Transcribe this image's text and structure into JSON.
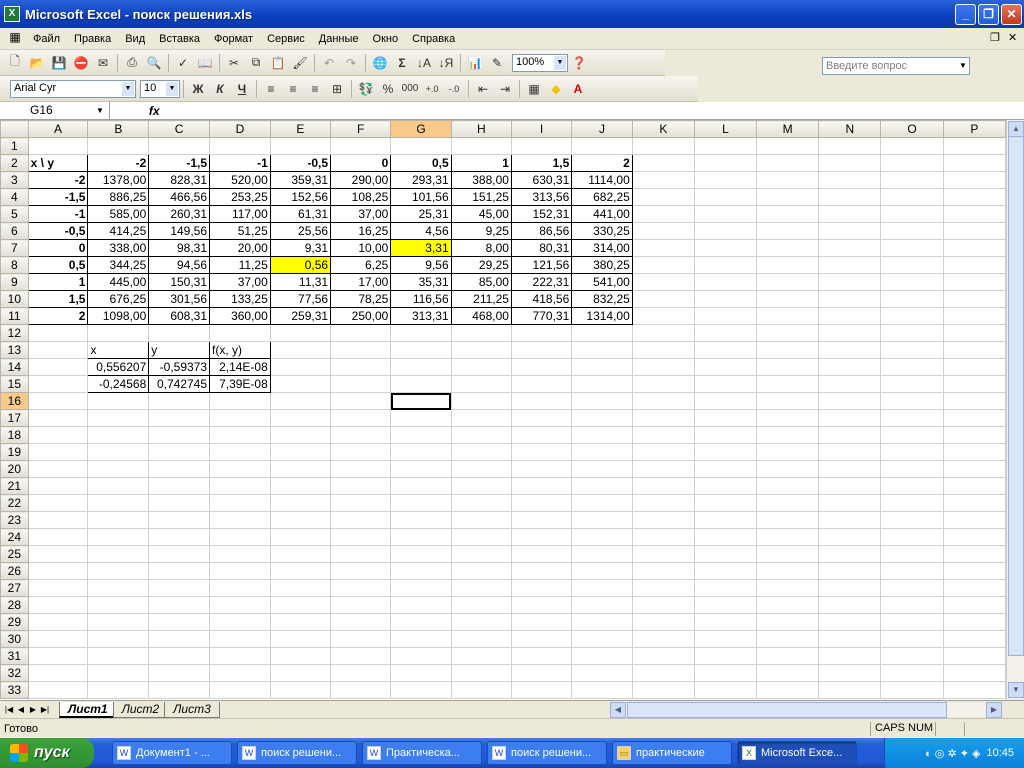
{
  "window": {
    "title": "Microsoft Excel - поиск решения.xls",
    "app_icon": "excel-icon"
  },
  "menu": [
    "Файл",
    "Правка",
    "Вид",
    "Вставка",
    "Формат",
    "Сервис",
    "Данные",
    "Окно",
    "Справка"
  ],
  "ask": {
    "placeholder": "Введите вопрос"
  },
  "toolbar": {
    "zoom": "100%"
  },
  "format_toolbar": {
    "font": "Arial Cyr",
    "size": "10",
    "bold": "Ж",
    "italic": "К",
    "underline": "Ч",
    "percent": "%",
    "thousands": "000"
  },
  "formula_bar": {
    "cell_ref": "G16",
    "fx": "fx",
    "content": ""
  },
  "columns": [
    "A",
    "B",
    "C",
    "D",
    "E",
    "F",
    "G",
    "H",
    "I",
    "J",
    "K",
    "L",
    "M",
    "N",
    "O",
    "P"
  ],
  "grid": {
    "header": [
      "x     \\     y",
      "-2",
      "-1,5",
      "-1",
      "-0,5",
      "0",
      "0,5",
      "1",
      "1,5",
      "2"
    ],
    "rows": [
      [
        "-2",
        "1378,00",
        "828,31",
        "520,00",
        "359,31",
        "290,00",
        "293,31",
        "388,00",
        "630,31",
        "1114,00"
      ],
      [
        "-1,5",
        "886,25",
        "466,56",
        "253,25",
        "152,56",
        "108,25",
        "101,56",
        "151,25",
        "313,56",
        "682,25"
      ],
      [
        "-1",
        "585,00",
        "260,31",
        "117,00",
        "61,31",
        "37,00",
        "25,31",
        "45,00",
        "152,31",
        "441,00"
      ],
      [
        "-0,5",
        "414,25",
        "149,56",
        "51,25",
        "25,56",
        "16,25",
        "4,56",
        "9,25",
        "86,56",
        "330,25"
      ],
      [
        "0",
        "338,00",
        "98,31",
        "20,00",
        "9,31",
        "10,00",
        "3,31",
        "8,00",
        "80,31",
        "314,00"
      ],
      [
        "0,5",
        "344,25",
        "94,56",
        "11,25",
        "0,56",
        "6,25",
        "9,56",
        "29,25",
        "121,56",
        "380,25"
      ],
      [
        "1",
        "445,00",
        "150,31",
        "37,00",
        "11,31",
        "17,00",
        "35,31",
        "85,00",
        "222,31",
        "541,00"
      ],
      [
        "1,5",
        "676,25",
        "301,56",
        "133,25",
        "77,56",
        "78,25",
        "116,56",
        "211,25",
        "418,56",
        "832,25"
      ],
      [
        "2",
        "1098,00",
        "608,31",
        "360,00",
        "259,31",
        "250,00",
        "313,31",
        "468,00",
        "770,31",
        "1314,00"
      ]
    ],
    "solution_header": [
      "x",
      "y",
      "f(x, y)"
    ],
    "solutions": [
      [
        "0,556207",
        "-0,59373",
        "2,14E-08"
      ],
      [
        "-0,24568",
        "0,742745",
        "7,39E-08"
      ]
    ],
    "highlight_color": "#ffff00"
  },
  "sheets": [
    "Лист1",
    "Лист2",
    "Лист3"
  ],
  "status": {
    "ready": "Готово",
    "caps_num": "CAPS NUM"
  },
  "taskbar": {
    "start": "пуск",
    "items": [
      "Документ1 - ...",
      "поиск решени...",
      "Практическа...",
      "поиск решени...",
      "практические",
      "Microsoft Exce..."
    ],
    "clock": "10:45"
  }
}
